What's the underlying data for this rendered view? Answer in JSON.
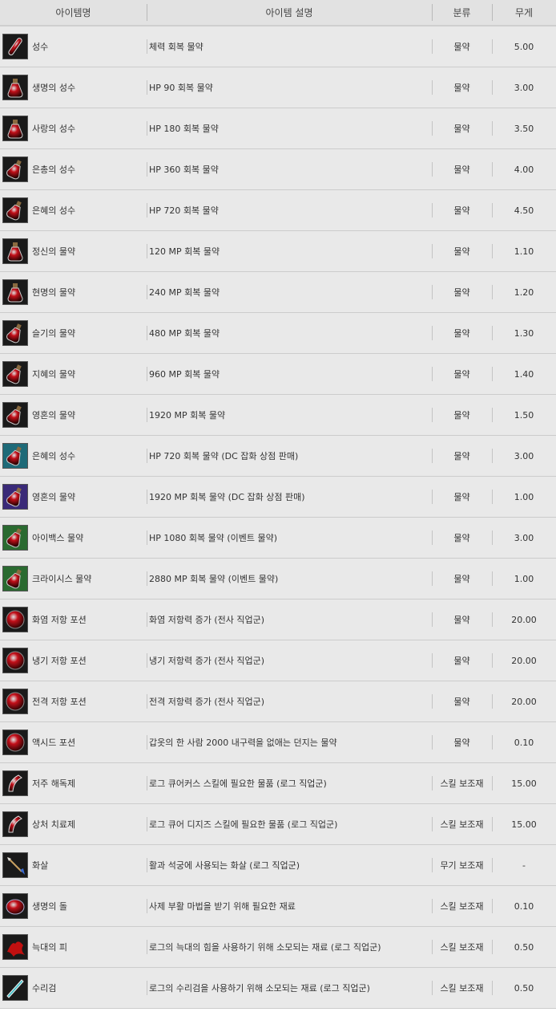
{
  "headers": {
    "name": "아이템명",
    "desc": "아이템 설명",
    "category": "분류",
    "weight": "무게"
  },
  "items": [
    {
      "icon": "red-potion-icon",
      "name": "성수",
      "desc": "체력 회복 물약",
      "category": "물약",
      "weight": "5.00",
      "color": "#c4101a",
      "shape": "vial"
    },
    {
      "icon": "red-potion-icon",
      "name": "생명의 성수",
      "desc": "HP 90 회복 물약",
      "category": "물약",
      "weight": "3.00",
      "color": "#d8141e",
      "shape": "flask"
    },
    {
      "icon": "red-potion-icon",
      "name": "사랑의 성수",
      "desc": "HP 180 회복 물약",
      "category": "물약",
      "weight": "3.50",
      "color": "#d8141e",
      "shape": "flask"
    },
    {
      "icon": "red-potion-icon",
      "name": "은총의 성수",
      "desc": "HP 360 회복 물약",
      "category": "물약",
      "weight": "4.00",
      "color": "#d8141e",
      "shape": "tilted"
    },
    {
      "icon": "red-potion-icon",
      "name": "은혜의 성수",
      "desc": "HP 720 회복 물약",
      "category": "물약",
      "weight": "4.50",
      "color": "#d8141e",
      "shape": "tilted"
    },
    {
      "icon": "blue-potion-icon",
      "name": "정신의 물약",
      "desc": "120 MP 회복 물약",
      "category": "물약",
      "weight": "1.10",
      "color": "#3040c8",
      "shape": "flask"
    },
    {
      "icon": "blue-potion-icon",
      "name": "현명의 물약",
      "desc": "240 MP 회복 물약",
      "category": "물약",
      "weight": "1.20",
      "color": "#3040c8",
      "shape": "flask"
    },
    {
      "icon": "blue-potion-icon",
      "name": "슬기의 물약",
      "desc": "480 MP 회복 물약",
      "category": "물약",
      "weight": "1.30",
      "color": "#3040c8",
      "shape": "tilted"
    },
    {
      "icon": "blue-potion-icon",
      "name": "지혜의 물약",
      "desc": "960 MP 회복 물약",
      "category": "물약",
      "weight": "1.40",
      "color": "#3040c8",
      "shape": "tilted"
    },
    {
      "icon": "blue-potion-icon",
      "name": "영혼의 물약",
      "desc": "1920 MP 회복 물약",
      "category": "물약",
      "weight": "1.50",
      "color": "#4058d8",
      "shape": "tilted"
    },
    {
      "icon": "red-potion-icon",
      "name": "은혜의 성수",
      "desc": "HP 720 회복 물약 (DC 잡화 상점 판매)",
      "category": "물약",
      "weight": "3.00",
      "color": "#d8141e",
      "shape": "tilted",
      "bg": "#1e6a78"
    },
    {
      "icon": "blue-potion-icon",
      "name": "영혼의 물약",
      "desc": "1920 MP 회복 물약 (DC 잡화 상점 판매)",
      "category": "물약",
      "weight": "1.00",
      "color": "#4058d8",
      "shape": "tilted",
      "bg": "#3a2a78"
    },
    {
      "icon": "red-potion-icon",
      "name": "아이백스 물약",
      "desc": "HP 1080 회복 물약 (이벤트 물약)",
      "category": "물약",
      "weight": "3.00",
      "color": "#d8141e",
      "shape": "tilted",
      "bg": "#2a6a30"
    },
    {
      "icon": "blue-potion-icon",
      "name": "크라이시스 물약",
      "desc": "2880 MP 회복 물약 (이벤트 물약)",
      "category": "물약",
      "weight": "1.00",
      "color": "#2c8ad8",
      "shape": "tilted",
      "bg": "#2a6a30"
    },
    {
      "icon": "fire-orb-icon",
      "name": "화염 저항 포션",
      "desc": "화염 저항력 증가 (전사 직업군)",
      "category": "물약",
      "weight": "20.00",
      "color": "#d82010",
      "shape": "orb"
    },
    {
      "icon": "ice-orb-icon",
      "name": "냉기 저항 포션",
      "desc": "냉기 저항력 증가 (전사 직업군)",
      "category": "물약",
      "weight": "20.00",
      "color": "#3a8ad8",
      "shape": "orb"
    },
    {
      "icon": "lightning-orb-icon",
      "name": "전격 저항 포션",
      "desc": "전격 저항력 증가 (전사 직업군)",
      "category": "물약",
      "weight": "20.00",
      "color": "#2a4ab0",
      "shape": "orb"
    },
    {
      "icon": "acid-orb-icon",
      "name": "액시드 포션",
      "desc": "갑옷의 한 사람 2000 내구력을 없애는 던지는 물약",
      "category": "물약",
      "weight": "0.10",
      "color": "#e81818",
      "shape": "orb"
    },
    {
      "icon": "horn-icon",
      "name": "저주 해독제",
      "desc": "로그 큐어커스 스킬에 필요한 물품 (로그 직업군)",
      "category": "스킬 보조재",
      "weight": "15.00",
      "color": "#d060c8",
      "shape": "horn"
    },
    {
      "icon": "horn-icon",
      "name": "상처 치료제",
      "desc": "로그 큐어 디지즈 스킬에 필요한 물품 (로그 직업군)",
      "category": "스킬 보조재",
      "weight": "15.00",
      "color": "#70c040",
      "shape": "horn"
    },
    {
      "icon": "arrow-icon",
      "name": "화살",
      "desc": "활과 석궁에 사용되는 화살 (로그 직업군)",
      "category": "무기 보조재",
      "weight": "-",
      "color": "#3a6ad0",
      "shape": "arrow"
    },
    {
      "icon": "stone-icon",
      "name": "생명의 돌",
      "desc": "사제 부활 마법을 받기 위해 필요한 재료",
      "category": "스킬 보조재",
      "weight": "0.10",
      "color": "#3a6ae0",
      "shape": "stone"
    },
    {
      "icon": "blood-icon",
      "name": "늑대의 피",
      "desc": "로그의 늑대의 힘을 사용하기 위해 소모되는 재료 (로그 직업군)",
      "category": "스킬 보조재",
      "weight": "0.50",
      "color": "#c01010",
      "shape": "blood"
    },
    {
      "icon": "shuriken-icon",
      "name": "수리검",
      "desc": "로그의 수리검을 사용하기 위해 소모되는 재료 (로그 직업군)",
      "category": "스킬 보조재",
      "weight": "0.50",
      "color": "#40c0c8",
      "shape": "blade"
    }
  ]
}
